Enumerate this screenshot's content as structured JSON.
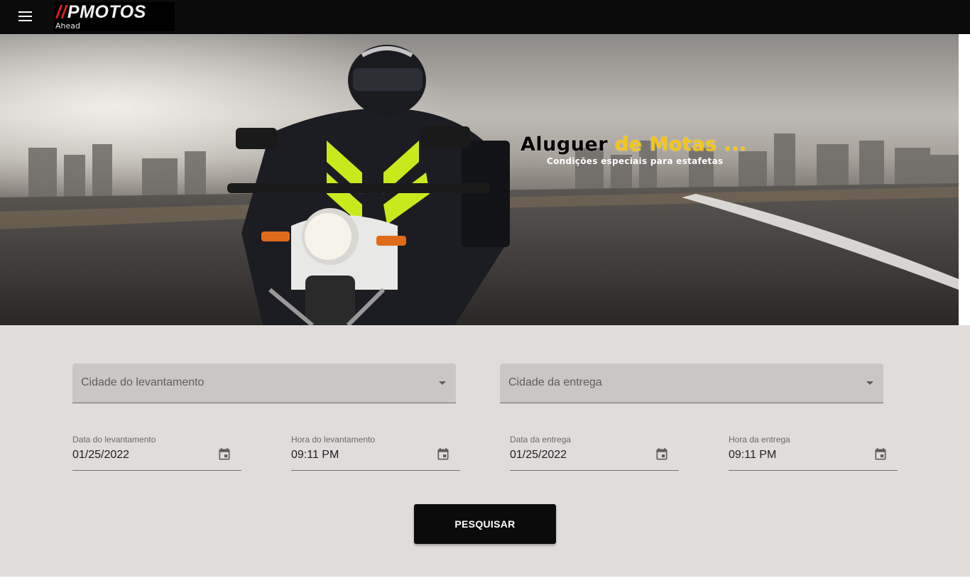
{
  "header": {
    "logo_main": "PMOTOS",
    "logo_slashes": "//",
    "logo_sub": "Ahead"
  },
  "hero": {
    "title_black": "Aluguer",
    "title_accent": "de Motas ...",
    "subtitle": "Condições especiais para estafetas",
    "accent_color": "#f4c417"
  },
  "form": {
    "pickup_city_label": "Cidade do levantamento",
    "delivery_city_label": "Cidade da entrega",
    "pickup_date": {
      "label": "Data do levantamento",
      "value": "01/25/2022"
    },
    "pickup_time": {
      "label": "Hora do levantamento",
      "value": "09:11 PM"
    },
    "delivery_date": {
      "label": "Data da entrega",
      "value": "01/25/2022"
    },
    "delivery_time": {
      "label": "Hora da entrega",
      "value": "09:11 PM"
    },
    "search_label": "PESQUISAR"
  },
  "icons": [
    "menu-icon",
    "calendar-icon",
    "dropdown-arrow-icon"
  ],
  "colors": {
    "topbar": "#0b0b0b",
    "background": "#e0dcdb",
    "button": "#0b0b0b",
    "logo_red": "#e2231a"
  }
}
